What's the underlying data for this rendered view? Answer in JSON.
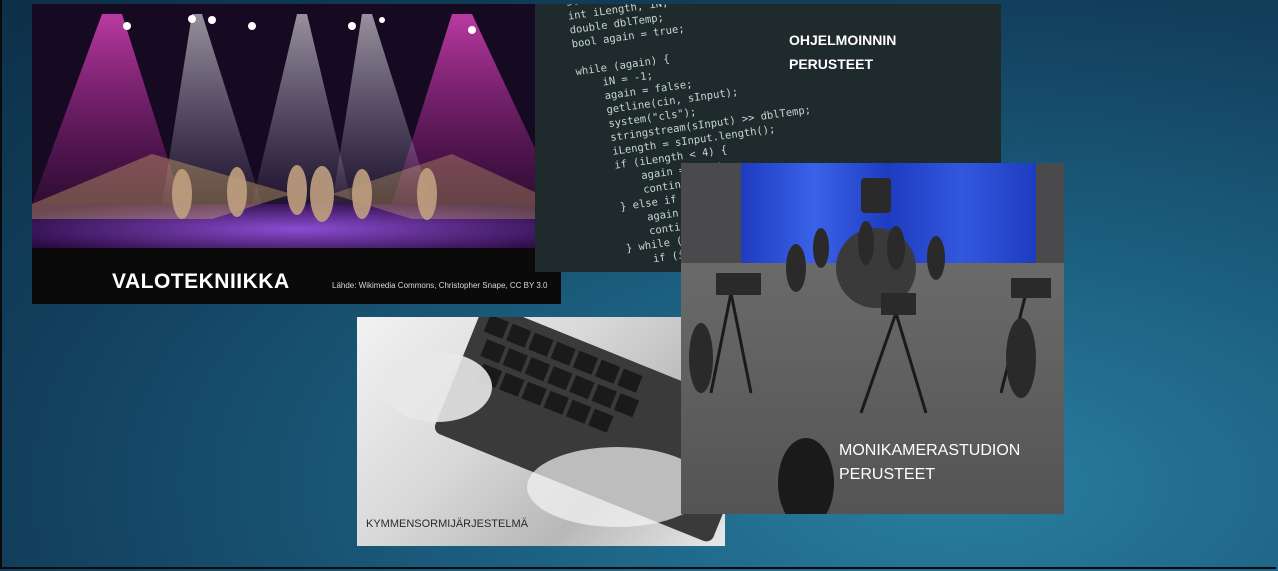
{
  "stage_photo": {
    "title": "VALOTEKNIIKKA",
    "credit": "Lähde: Wikimedia Commons, Christopher Snape, CC BY 3.0"
  },
  "code_photo": {
    "title": "OHJELMOINNIN\nPERUSTEET",
    "code_text": "string sInput;\nint iLength, iN;\ndouble dblTemp;\nbool again = true;\n\nwhile (again) {\n    iN = -1;\n    again = false;\n    getline(cin, sInput);\n    system(\"cls\");\n    stringstream(sInput) >> dblTemp;\n    iLength = sInput.length();\n    if (iLength < 4) {\n        again = true;\n        continue;\n    } else if (sInput\n        again = true;\n        continue;\n    } while (++iN < i\n        if (isdigit(s\n            continue;\n        else if (iN"
  },
  "typing_photo": {
    "caption": "KYMMENSORMIJÄRJESTELMÄ"
  },
  "studio_photo": {
    "title": "MONIKAMERASTUDION\nPERUSTEET"
  },
  "colors": {
    "background_dark": "#0d2f47",
    "background_light": "#2a7ea0",
    "curtain_blue": "#1e3cc0"
  }
}
